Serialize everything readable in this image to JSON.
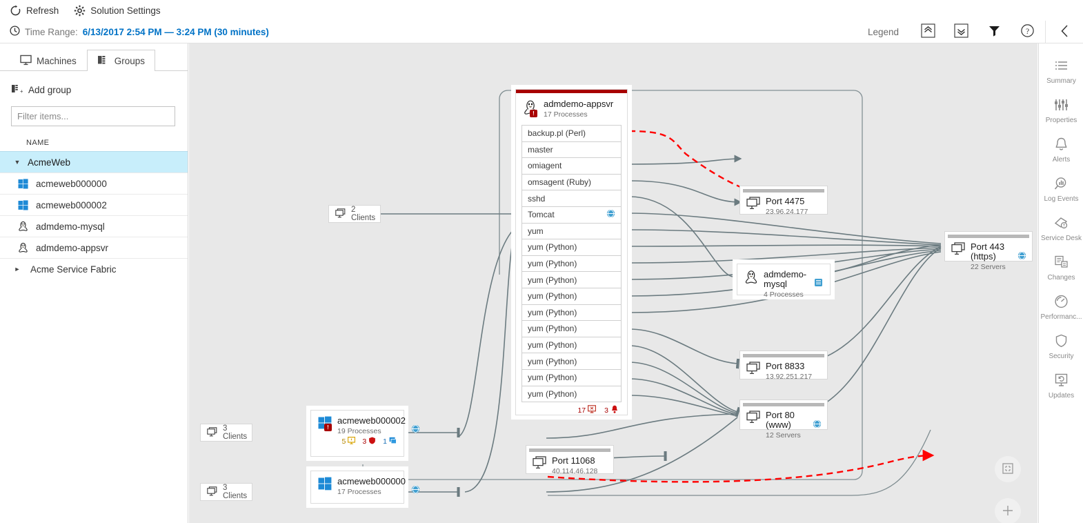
{
  "toolbar": {
    "refresh_label": "Refresh",
    "settings_label": "Solution Settings"
  },
  "timebar": {
    "label": "Time Range:",
    "value": "6/13/2017 2:54 PM — 3:24 PM (30 minutes)",
    "legend_label": "Legend"
  },
  "sidebar": {
    "tabs": [
      {
        "label": "Machines",
        "icon": "monitor-icon",
        "active": false
      },
      {
        "label": "Groups",
        "icon": "groups-icon",
        "active": true
      }
    ],
    "add_group_label": "Add group",
    "filter_placeholder": "Filter items...",
    "column_header": "NAME",
    "tree": [
      {
        "label": "AcmeWeb",
        "type": "group",
        "expanded": true,
        "icon": "caret-down-icon"
      },
      {
        "label": "acmeweb000000",
        "type": "machine",
        "icon": "windows-icon"
      },
      {
        "label": "acmeweb000002",
        "type": "machine",
        "icon": "windows-icon"
      },
      {
        "label": "admdemo-mysql",
        "type": "machine",
        "icon": "linux-icon"
      },
      {
        "label": "admdemo-appsvr",
        "type": "machine",
        "icon": "linux-icon"
      },
      {
        "label": "Acme Service Fabric",
        "type": "group",
        "expanded": false,
        "icon": "caret-right-icon"
      }
    ]
  },
  "graph": {
    "process_card": {
      "title": "admdemo-appsvr",
      "subtitle": "17 Processes",
      "icon": "linux-icon",
      "alert": true,
      "processes": [
        {
          "name": "backup.pl (Perl)"
        },
        {
          "name": "master"
        },
        {
          "name": "omiagent"
        },
        {
          "name": "omsagent (Ruby)"
        },
        {
          "name": "sshd"
        },
        {
          "name": "Tomcat",
          "icon": "globe-icon"
        },
        {
          "name": "yum"
        },
        {
          "name": "yum (Python)"
        },
        {
          "name": "yum (Python)"
        },
        {
          "name": "yum (Python)"
        },
        {
          "name": "yum (Python)"
        },
        {
          "name": "yum (Python)"
        },
        {
          "name": "yum (Python)"
        },
        {
          "name": "yum (Python)"
        },
        {
          "name": "yum (Python)"
        },
        {
          "name": "yum (Python)"
        },
        {
          "name": "yum (Python)"
        }
      ],
      "footer_badges": [
        {
          "count": "17",
          "icon": "monitor-failed-icon"
        },
        {
          "count": "3",
          "icon": "alert-bell-icon"
        }
      ]
    },
    "machines": [
      {
        "id": "acmeweb000002",
        "title": "acmeweb000002",
        "subtitle": "19 Processes",
        "icon": "windows-icon",
        "alert": true,
        "globe": true,
        "badges": [
          {
            "count": "5",
            "icon": "monitor-warning-icon",
            "color": "y"
          },
          {
            "count": "3",
            "icon": "shield-icon",
            "color": "r"
          },
          {
            "count": "1",
            "icon": "update-icon",
            "color": "b"
          }
        ]
      },
      {
        "id": "acmeweb000000",
        "title": "acmeweb000000",
        "subtitle": "17 Processes",
        "icon": "windows-icon",
        "alert": false,
        "globe": true,
        "badges": []
      }
    ],
    "endpoints": [
      {
        "id": "port4475",
        "title": "Port 4475",
        "subtitle": "23.96.24.177",
        "icon": "servers-icon",
        "globe": false
      },
      {
        "id": "mysql",
        "title": "admdemo-mysql",
        "subtitle": "4 Processes",
        "icon": "linux-icon",
        "db": true
      },
      {
        "id": "port8833",
        "title": "Port 8833",
        "subtitle": "13.92.251.217",
        "icon": "servers-icon",
        "globe": false
      },
      {
        "id": "port80",
        "title": "Port 80 (www)",
        "subtitle": "12 Servers",
        "icon": "servers-icon",
        "globe": true
      },
      {
        "id": "port11068",
        "title": "Port 11068",
        "subtitle": "40.114.46.128",
        "icon": "servers-icon",
        "globe": false
      },
      {
        "id": "port443",
        "title": "Port 443 (https)",
        "subtitle": "22 Servers",
        "icon": "servers-icon",
        "globe": true
      }
    ],
    "client_groups": [
      {
        "id": "clients2",
        "label": "2 Clients",
        "icon": "servers-icon"
      },
      {
        "id": "clients3a",
        "label": "3 Clients",
        "icon": "servers-icon"
      },
      {
        "id": "clients3b",
        "label": "3 Clients",
        "icon": "servers-icon"
      }
    ],
    "colors": {
      "link": "#6b7b80",
      "failed_link": "#ff0000",
      "alert_red": "#a80000",
      "accent_blue": "#0072c6",
      "selection_blue": "#c8eefb"
    }
  },
  "right_rail": [
    {
      "label": "Summary",
      "icon": "list-icon"
    },
    {
      "label": "Properties",
      "icon": "sliders-icon"
    },
    {
      "label": "Alerts",
      "icon": "bell-icon"
    },
    {
      "label": "Log Events",
      "icon": "search-chart-icon"
    },
    {
      "label": "Service Desk",
      "icon": "ticket-icon"
    },
    {
      "label": "Changes",
      "icon": "document-change-icon"
    },
    {
      "label": "Performanc...",
      "icon": "gauge-icon"
    },
    {
      "label": "Security",
      "icon": "shield-icon"
    },
    {
      "label": "Updates",
      "icon": "monitor-refresh-icon"
    }
  ],
  "zoom_controls": [
    {
      "id": "fit",
      "icon": "fit-to-screen-icon"
    },
    {
      "id": "zoomin",
      "icon": "plus-icon"
    }
  ]
}
